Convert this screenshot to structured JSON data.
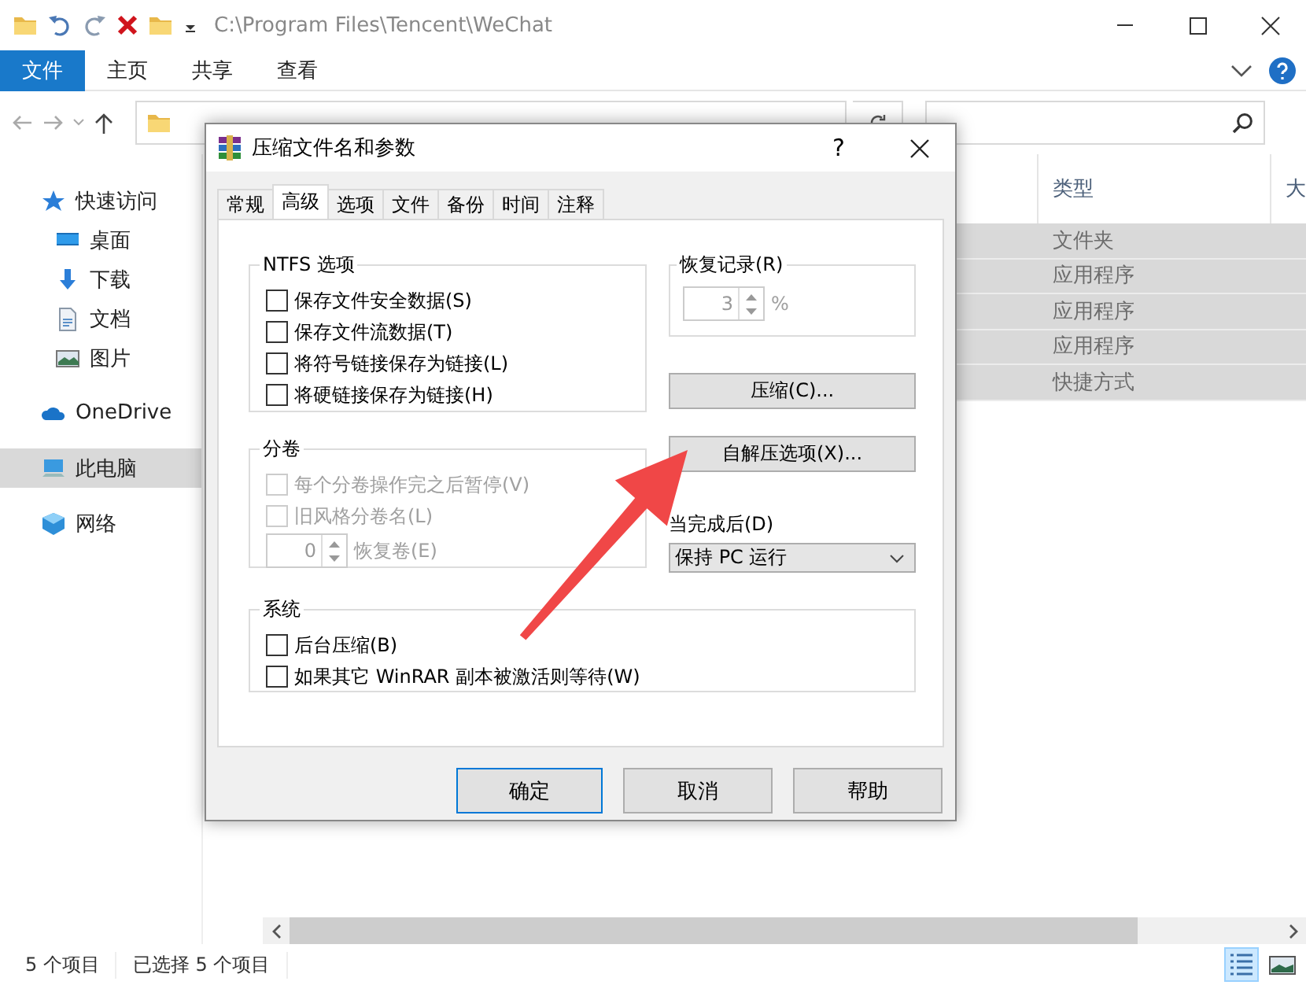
{
  "window": {
    "title": "C:\\Program Files\\Tencent\\WeChat"
  },
  "ribbon_tabs": [
    {
      "label": "文件",
      "selected": true
    },
    {
      "label": "主页",
      "selected": false
    },
    {
      "label": "共享",
      "selected": false
    },
    {
      "label": "查看",
      "selected": false
    }
  ],
  "sidebar": {
    "items": [
      {
        "label": "快速访问",
        "selected": false,
        "children": [
          {
            "label": "桌面",
            "selected": false
          },
          {
            "label": "下载",
            "selected": false
          },
          {
            "label": "文档",
            "selected": false
          },
          {
            "label": "图片",
            "selected": false
          }
        ]
      },
      {
        "label": "OneDrive",
        "selected": false
      },
      {
        "label": "此电脑",
        "selected": true
      },
      {
        "label": "网络",
        "selected": false
      }
    ]
  },
  "table": {
    "columns": [
      "类型",
      "大"
    ],
    "rows": [
      {
        "type": "文件夹",
        "selected": true
      },
      {
        "type": "应用程序",
        "selected": true
      },
      {
        "type": "应用程序",
        "selected": true
      },
      {
        "type": "应用程序",
        "selected": true
      },
      {
        "type": "快捷方式",
        "selected": true
      }
    ]
  },
  "status_bar": {
    "count": "5 个项目",
    "selection": "已选择 5 个项目",
    "views": [
      {
        "selected": true
      },
      {
        "selected": false
      }
    ]
  },
  "dialog": {
    "title": "压缩文件名和参数",
    "help": "?",
    "tabs": [
      {
        "label": "常规",
        "selected": false
      },
      {
        "label": "高级",
        "selected": true
      },
      {
        "label": "选项",
        "selected": false
      },
      {
        "label": "文件",
        "selected": false
      },
      {
        "label": "备份",
        "selected": false
      },
      {
        "label": "时间",
        "selected": false
      },
      {
        "label": "注释",
        "selected": false
      }
    ],
    "ntfs": {
      "title": "NTFS 选项",
      "options": [
        {
          "label": "保存文件安全数据(S)",
          "checked": false,
          "disabled": false
        },
        {
          "label": "保存文件流数据(T)",
          "checked": false,
          "disabled": false
        },
        {
          "label": "将符号链接保存为链接(L)",
          "checked": false,
          "disabled": false
        },
        {
          "label": "将硬链接保存为链接(H)",
          "checked": false,
          "disabled": false
        }
      ]
    },
    "volumes": {
      "title": "分卷",
      "options": [
        {
          "label": "每个分卷操作完之后暂停(V)",
          "checked": false,
          "disabled": true
        },
        {
          "label": "旧风格分卷名(L)",
          "checked": false,
          "disabled": true
        }
      ],
      "spin": {
        "value": "0",
        "label": "恢复卷(E)",
        "disabled": true
      }
    },
    "recovery": {
      "title": "恢复记录(R)",
      "spin": {
        "value": "3",
        "label": "%",
        "disabled": true
      }
    },
    "side_buttons": [
      "压缩(C)...",
      "自解压选项(X)..."
    ],
    "on_finish": {
      "label": "当完成后(D)",
      "value": "保持 PC 运行"
    },
    "system": {
      "title": "系统",
      "options": [
        {
          "label": "后台压缩(B)",
          "checked": false,
          "disabled": false
        },
        {
          "label": "如果其它 WinRAR 副本被激活则等待(W)",
          "checked": false,
          "disabled": false
        }
      ]
    },
    "buttons": [
      {
        "label": "确定",
        "default": true
      },
      {
        "label": "取消",
        "default": false
      },
      {
        "label": "帮助",
        "default": false
      }
    ]
  }
}
